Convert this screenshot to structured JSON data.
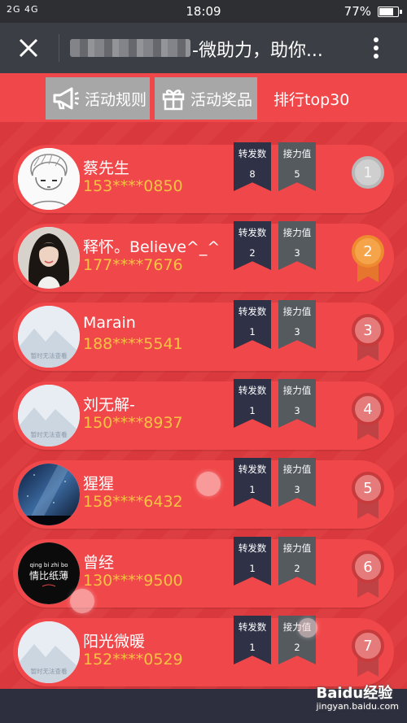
{
  "status_bar": {
    "signal": "2G 4G",
    "time": "18:09",
    "battery": "77%"
  },
  "header": {
    "title": "-微助力，助你..."
  },
  "tabs": [
    {
      "label": "活动规则",
      "icon": "megaphone-icon"
    },
    {
      "label": "活动奖品",
      "icon": "gift-icon"
    },
    {
      "label": "排行top30",
      "active": true
    }
  ],
  "ranking": {
    "forward_label": "转发数",
    "power_label": "接力值",
    "entries": [
      {
        "rank": "1",
        "name": "蔡先生",
        "phone": "153****0850",
        "forwards": "8",
        "power": "5",
        "medal": "silver",
        "avatar": "sketch"
      },
      {
        "rank": "2",
        "name": "释怀。Believe^_^",
        "phone": "177****7676",
        "forwards": "2",
        "power": "3",
        "medal": "gold",
        "avatar": "photo"
      },
      {
        "rank": "3",
        "name": "Marain",
        "phone": "188****5541",
        "forwards": "1",
        "power": "3",
        "medal": "red",
        "avatar": "placeholder"
      },
      {
        "rank": "4",
        "name": "刘无解-",
        "phone": "150****8937",
        "forwards": "1",
        "power": "3",
        "medal": "red",
        "avatar": "placeholder"
      },
      {
        "rank": "5",
        "name": "猩猩",
        "phone": "158****6432",
        "forwards": "1",
        "power": "3",
        "medal": "red",
        "avatar": "galaxy"
      },
      {
        "rank": "6",
        "name": "曾经",
        "phone": "130****9500",
        "forwards": "1",
        "power": "2",
        "medal": "red",
        "avatar": "text"
      },
      {
        "rank": "7",
        "name": "阳光微暖",
        "phone": "152****0529",
        "forwards": "1",
        "power": "2",
        "medal": "red",
        "avatar": "placeholder"
      }
    ]
  },
  "avatar_text": {
    "placeholder": "暂时无法查看",
    "text_top": "qing bi zhi bo",
    "text_main": "情比纸薄"
  },
  "watermark": {
    "brand": "Baidu经验",
    "url": "jingyan.baidu.com"
  },
  "colors": {
    "page_bg": "#d93a3d",
    "row_bg": "#f0484a",
    "phone": "#f7c244",
    "forward_ribbon": "#2f3147",
    "power_ribbon": "#555a5f"
  }
}
